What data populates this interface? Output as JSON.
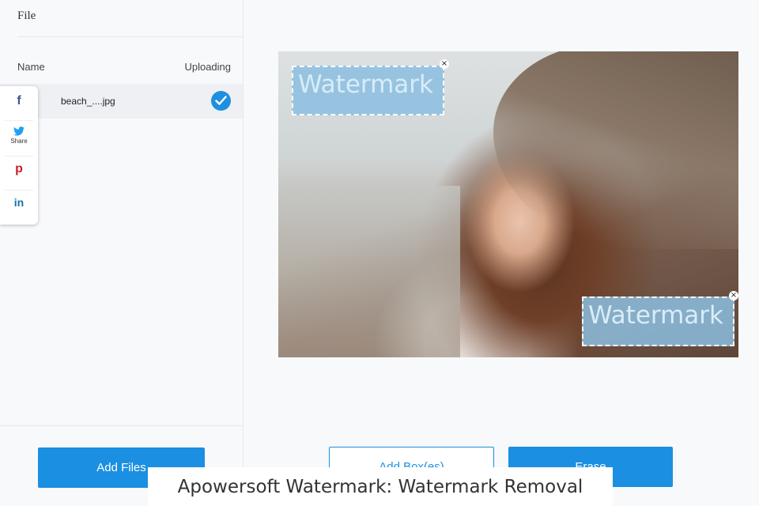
{
  "left_panel": {
    "title": "File",
    "columns": {
      "name": "Name",
      "uploading": "Uploading"
    },
    "files": [
      {
        "name": "beach_....jpg",
        "status": "done"
      }
    ],
    "add_files_label": "Add Files"
  },
  "social": {
    "items": [
      {
        "icon": "facebook-icon",
        "glyph": "f"
      },
      {
        "icon": "twitter-icon",
        "label": "Share"
      },
      {
        "icon": "pinterest-icon",
        "glyph": "p"
      },
      {
        "icon": "linkedin-icon",
        "glyph": "in"
      }
    ]
  },
  "preview": {
    "watermarks": [
      {
        "text": "Watermark"
      },
      {
        "text": "Watermark"
      }
    ]
  },
  "actions": {
    "add_box_label": "Add Box(es)",
    "erase_label": "Erase"
  },
  "caption": "Apowersoft Watermark: Watermark Removal",
  "colors": {
    "accent": "#1b8fe1",
    "watermark_box": "#8cbee1"
  }
}
